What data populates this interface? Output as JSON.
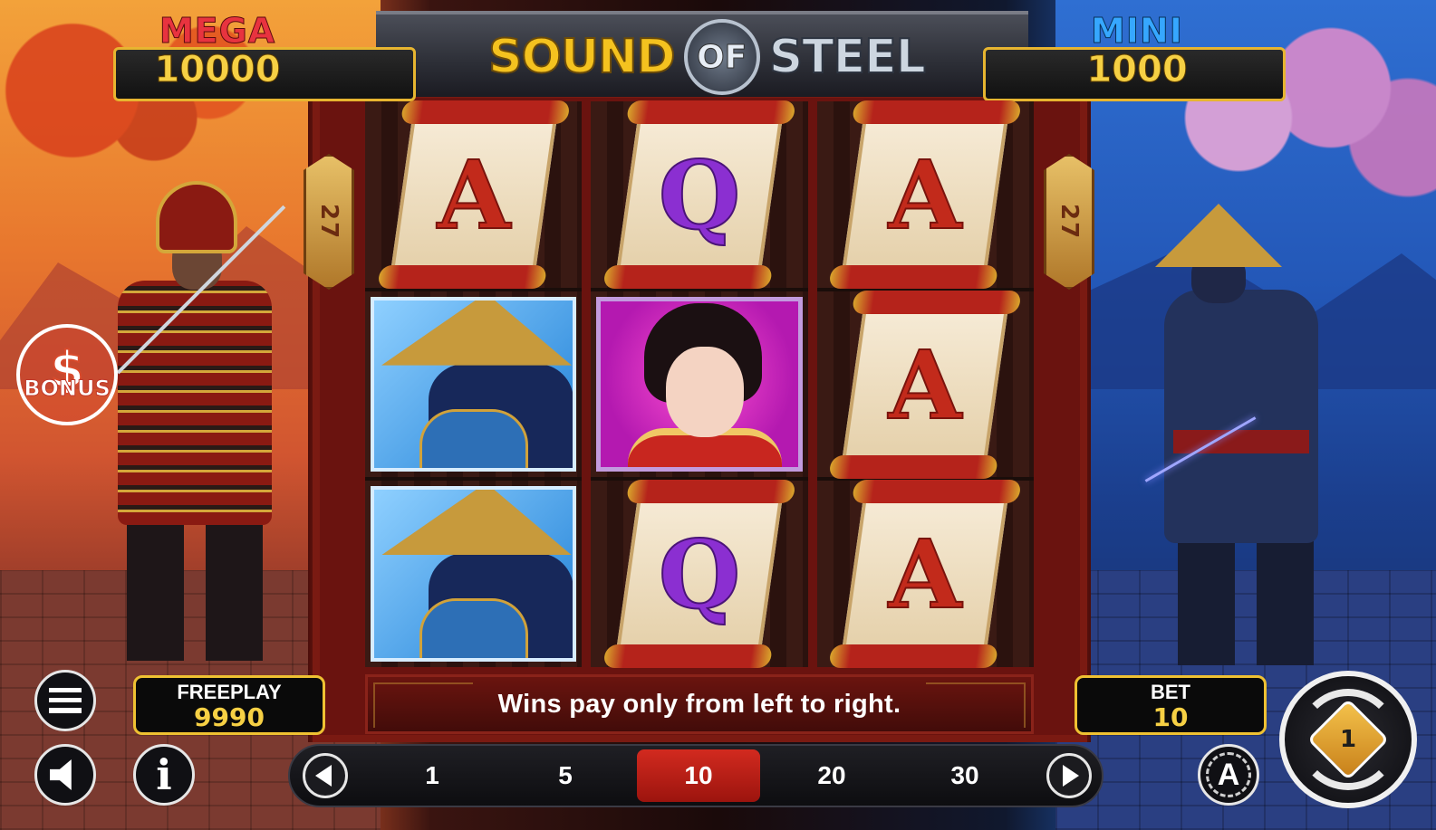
{
  "game": {
    "title_part1": "SOUND",
    "title_part2": "OF",
    "title_part3": "STEEL"
  },
  "jackpots": {
    "mega": {
      "label": "MEGA",
      "value": "10000"
    },
    "mini": {
      "label": "MINI",
      "value": "1000"
    }
  },
  "paylines": {
    "left": "27",
    "right": "27"
  },
  "reels": [
    [
      {
        "symbol": "A",
        "kind": "scroll"
      },
      {
        "symbol": "ninja",
        "kind": "character"
      },
      {
        "symbol": "ninja",
        "kind": "character"
      }
    ],
    [
      {
        "symbol": "Q",
        "kind": "scroll"
      },
      {
        "symbol": "geisha",
        "kind": "character"
      },
      {
        "symbol": "Q",
        "kind": "scroll"
      }
    ],
    [
      {
        "symbol": "A",
        "kind": "scroll"
      },
      {
        "symbol": "A",
        "kind": "scroll"
      },
      {
        "symbol": "A",
        "kind": "scroll"
      }
    ]
  ],
  "message": "Wins pay only from left to right.",
  "freeplay": {
    "label": "FREEPLAY",
    "value": "9990"
  },
  "bet": {
    "label": "BET",
    "value": "10"
  },
  "bet_options": [
    "1",
    "5",
    "10",
    "20",
    "30"
  ],
  "selected_bet": "10",
  "bonus": {
    "symbol": "$",
    "label": "BONUS"
  },
  "info_glyph": "i",
  "auto_glyph": "A",
  "spin_glyph": "1",
  "colors": {
    "gold": "#efc132",
    "mega_red": "#e8333f",
    "mini_blue": "#36a7ff",
    "selected_bet_red": "#d22a1f"
  },
  "icons": [
    "menu-icon",
    "speaker-icon",
    "info-icon",
    "prev-arrow-icon",
    "next-arrow-icon",
    "autoplay-icon",
    "spin-icon",
    "bonus-icon"
  ]
}
